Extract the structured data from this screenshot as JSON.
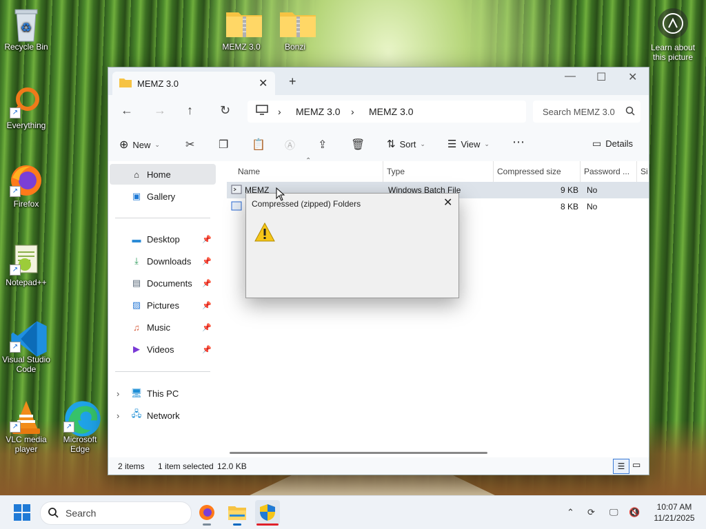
{
  "desktop": {
    "icons": [
      {
        "label": "Recycle Bin",
        "icon": "recycle-bin-icon"
      },
      {
        "label": "Everything",
        "icon": "magnifier-icon"
      },
      {
        "label": "Firefox",
        "icon": "firefox-icon"
      },
      {
        "label": "Notepad++",
        "icon": "notepad-plus-icon"
      },
      {
        "label": "Visual Studio Code",
        "icon": "vscode-icon"
      },
      {
        "label": "VLC media player",
        "icon": "vlc-icon"
      },
      {
        "label": "Microsoft Edge",
        "icon": "edge-icon"
      },
      {
        "label": "MEMZ 3.0",
        "icon": "zip-folder-icon"
      },
      {
        "label": "Bonzi",
        "icon": "zip-folder-icon"
      }
    ],
    "learn_label": "Learn about this picture"
  },
  "explorer": {
    "tab_label": "MEMZ 3.0",
    "breadcrumb": [
      "MEMZ 3.0",
      "MEMZ 3.0"
    ],
    "search_placeholder": "Search MEMZ 3.0",
    "toolbar": {
      "new": "New",
      "sort": "Sort",
      "view": "View",
      "details": "Details"
    },
    "nav": {
      "home": "Home",
      "gallery": "Gallery",
      "quick": [
        "Desktop",
        "Downloads",
        "Documents",
        "Pictures",
        "Music",
        "Videos"
      ],
      "this_pc": "This PC",
      "network": "Network"
    },
    "columns": [
      "Name",
      "Type",
      "Compressed size",
      "Password ...",
      "Si"
    ],
    "rows": [
      {
        "name": "MEMZ",
        "type": "Windows Batch File",
        "size": "9 KB",
        "password": "No"
      },
      {
        "name": "",
        "type": "",
        "size": "8 KB",
        "password": "No"
      }
    ],
    "status": {
      "items": "2 items",
      "selected": "1 item selected",
      "size": "12.0 KB"
    }
  },
  "dialog": {
    "title": "Compressed (zipped) Folders"
  },
  "taskbar": {
    "search": "Search",
    "time": "10:07 AM",
    "date": "11/21/2025"
  },
  "colors": {
    "accent": "#0067c0",
    "window_chrome": "#e6ecf2",
    "selection": "#dde3ea"
  }
}
